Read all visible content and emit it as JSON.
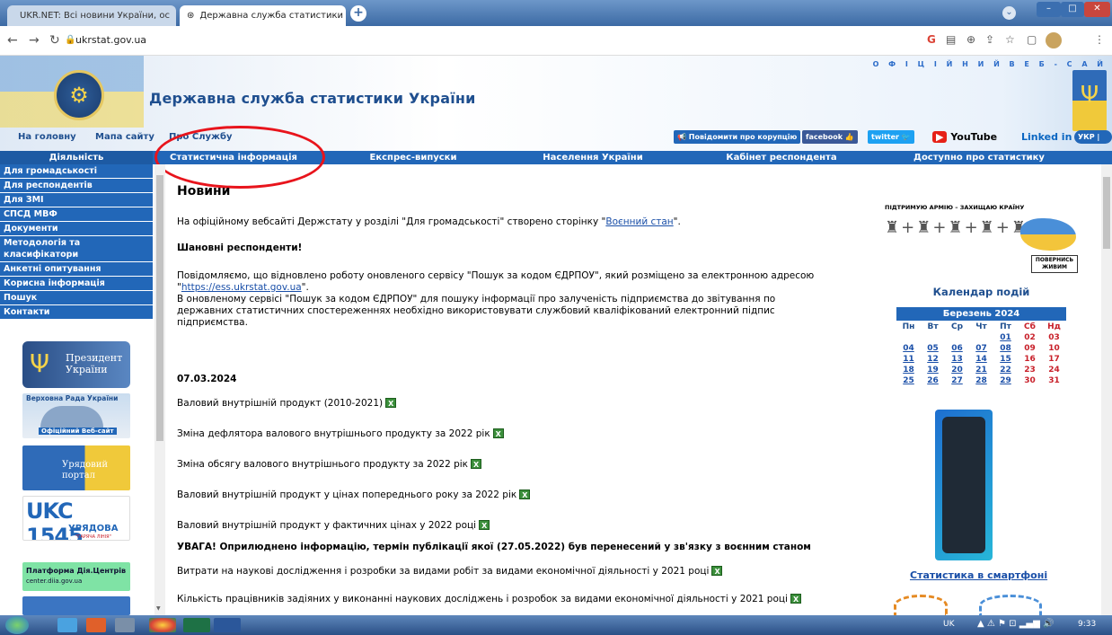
{
  "browser": {
    "tabs": [
      {
        "title": "UKR.NET: Всі новини України, ос",
        "active": false
      },
      {
        "title": "Державна служба статистики Ук",
        "active": true
      }
    ],
    "new_tab": "+",
    "url": "ukrstat.gov.ua"
  },
  "header": {
    "site_title": "Державна служба статистики України",
    "official_label": "О Ф І Ц І Й Н И Й   В Е Б - С А Й",
    "top_links": [
      "На головну",
      "Мапа сайту",
      "Про Службу"
    ],
    "badges": [
      "Повідомити про корупцію",
      "facebook",
      "twitter",
      "YouTube",
      "Linked in",
      "УКР | ENG"
    ]
  },
  "nav": {
    "left_heading": "Діяльність",
    "items": [
      "Статистична інформація",
      "Експрес-випуски",
      "Населення України",
      "Кабінет респондента",
      "Доступно про статистику"
    ]
  },
  "sidebar": {
    "items": [
      "Для громадськості",
      "Для респондентів",
      "Для ЗМІ",
      "СПСД МВФ",
      "Документи",
      "Методологія та класифікатори",
      "Анкетні опитування",
      "Корисна інформація",
      "Пошук",
      "Контакти"
    ],
    "banners": [
      "Президент України",
      "Верховна Рада України",
      "Урядовий портал",
      "UKC 1545",
      "Платформа Дія.Центрів"
    ],
    "banner_sub": {
      "rada": "Офіційний Веб-сайт",
      "ukc": "УРЯДОВА",
      "ukc_line": "\"ГАРЯЧА ЛІНІЯ\"",
      "dia": "center.diia.gov.ua"
    }
  },
  "main": {
    "title": "Новини",
    "p1_prefix": "На офіційному вебсайті Держстату у розділі \"Для громадськості\" створено сторінку \"",
    "p1_link": "Воєнний стан",
    "p1_suffix": "\".",
    "respondents": "Шановні респонденти!",
    "p2_a": "Повідомляємо, що відновлено роботу оновленого сервісу \"Пошук за кодом ЄДРПОУ\", який розміщено за електронною адресою",
    "p2_link": "https://ess.ukrstat.gov.ua",
    "p2_b": "В оновленому сервісі \"Пошук за кодом ЄДРПОУ\" для пошуку інформації про залученість підприємства до звітування по державних статистичних спостереженнях необхідно використовувати службовий кваліфікований електронний підпис підприємства.",
    "date": "07.03.2024",
    "items": [
      "Валовий внутрішній продукт (2010-2021)",
      "Зміна дефлятора валового внутрішнього продукту за 2022 рік",
      "Зміна обсягу валового внутрішнього продукту за 2022 рік",
      "Валовий внутрішній продукт у цінах попереднього року за 2022 рік",
      "Валовий внутрішній продукт у фактичних цінах у 2022 році"
    ],
    "warning": "УВАГА! Оприлюднено інформацію, термін публікації якої (27.05.2022) був перенесений у зв'язку з воєнним станом",
    "items2": [
      "Витрати на наукові дослідження і розробки за видами робіт за видами економічної діяльності у 2021 році",
      "Кількість працівників задіяних у виконанні наукових досліджень і розробок за видами економічної діяльності у 2021 році"
    ]
  },
  "right": {
    "army": "ПІДТРИМУЮ АРМІЮ – ЗАХИЩАЮ КРАЇНУ",
    "army_badge": "ПОВЕРНИСЬ ЖИВИМ",
    "calendar_title": "Календар подій",
    "month": "Березень 2024",
    "weekdays": [
      "Пн",
      "Вт",
      "Ср",
      "Чт",
      "Пт",
      "Сб",
      "Нд"
    ],
    "days": [
      "",
      "",
      "",
      "",
      "01",
      "02",
      "03",
      "04",
      "05",
      "06",
      "07",
      "08",
      "09",
      "10",
      "11",
      "12",
      "13",
      "14",
      "15",
      "16",
      "17",
      "18",
      "19",
      "20",
      "21",
      "22",
      "23",
      "24",
      "25",
      "26",
      "27",
      "28",
      "29",
      "30",
      "31"
    ],
    "phone_link": "Статистика в смартфоні"
  },
  "taskbar": {
    "lang": "UK",
    "time": "9:33"
  }
}
